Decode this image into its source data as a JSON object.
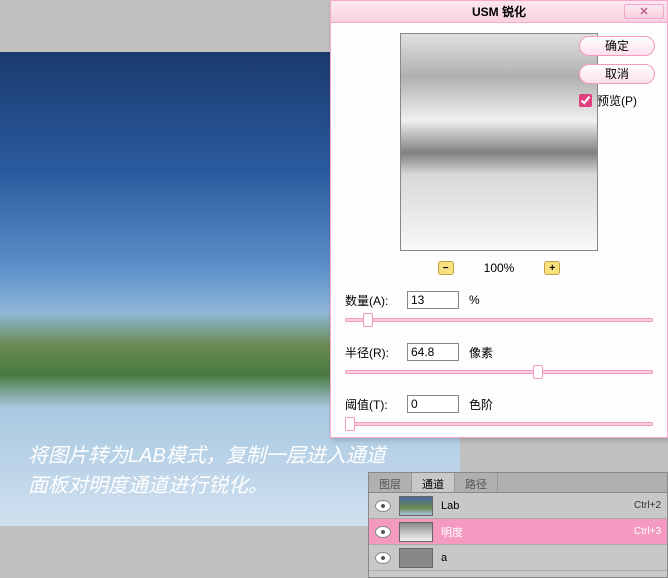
{
  "dialog": {
    "title": "USM 锐化",
    "ok_label": "确定",
    "cancel_label": "取消",
    "preview_label": "预览(P)",
    "zoom_level": "100%",
    "amount_label": "数量(A):",
    "amount_value": "13",
    "amount_unit": "%",
    "radius_label": "半径(R):",
    "radius_value": "64.8",
    "radius_unit": "像素",
    "threshold_label": "阈值(T):",
    "threshold_value": "0",
    "threshold_unit": "色阶"
  },
  "caption": {
    "line1": "将图片转为LAB模式，复制一层进入通道",
    "line2": "面板对明度通道进行锐化。"
  },
  "panel": {
    "tab_layers": "图层",
    "tab_channels": "通道",
    "tab_paths": "路径",
    "channels": [
      {
        "name": "Lab",
        "shortcut": "Ctrl+2"
      },
      {
        "name": "明度",
        "shortcut": "Ctrl+3"
      },
      {
        "name": "a",
        "shortcut": ""
      }
    ]
  }
}
